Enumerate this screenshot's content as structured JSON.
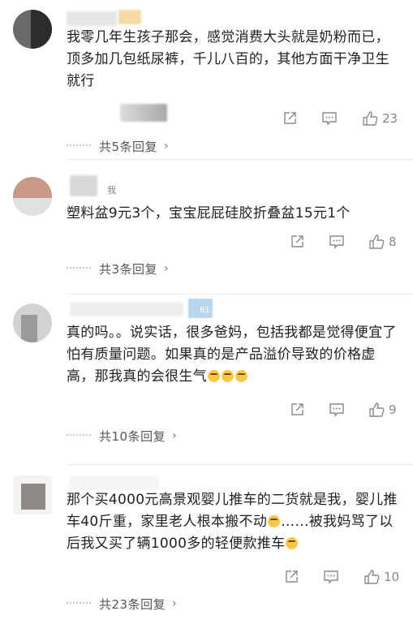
{
  "comments": [
    {
      "text": "我零几年生孩子那会，感觉消费大头就是奶粉而已，顶多加几包纸尿裤，千儿八百的，其他方面干净卫生就行",
      "likes": "23",
      "replies": "共5条回复"
    },
    {
      "name_visible": "我",
      "text": "塑料盆9元3个，宝宝屁屁硅胶折叠盆15元1个",
      "likes": "8",
      "replies": "共3条回复"
    },
    {
      "name_visible": "81",
      "text": "真的吗。。说实话，很多爸妈，包括我都是觉得便宜了怕有质量问题。如果真的是产品溢价导致的价格虚高，那我真的会很生气",
      "likes": "9",
      "replies": "共10条回复"
    },
    {
      "text_a": "那个买4000元高景观婴儿推车的二货就是我，婴儿推车40斤重，家里老人根本搬不动",
      "text_b": "……被我妈骂了以后我又买了辆1000多的轻便款推车",
      "likes": "10",
      "replies": "共23条回复"
    }
  ],
  "icons": {
    "share": "share-icon",
    "comment": "comment-icon",
    "like": "thumbs-up-icon",
    "chevron": "›"
  }
}
